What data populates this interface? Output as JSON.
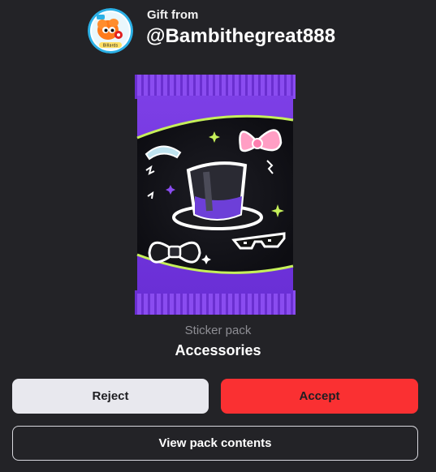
{
  "gift": {
    "from_label": "Gift from",
    "username": "@Bambithegreat888",
    "avatar_text": "Billards"
  },
  "pack": {
    "type": "Sticker pack",
    "name": "Accessories"
  },
  "actions": {
    "reject_label": "Reject",
    "accept_label": "Accept",
    "view_label": "View pack contents"
  },
  "colors": {
    "background": "#232327",
    "accept": "#fa3032",
    "reject": "#e8e8ee",
    "pack_purple": "#7b3fe4",
    "pack_accent": "#c6f05a"
  }
}
